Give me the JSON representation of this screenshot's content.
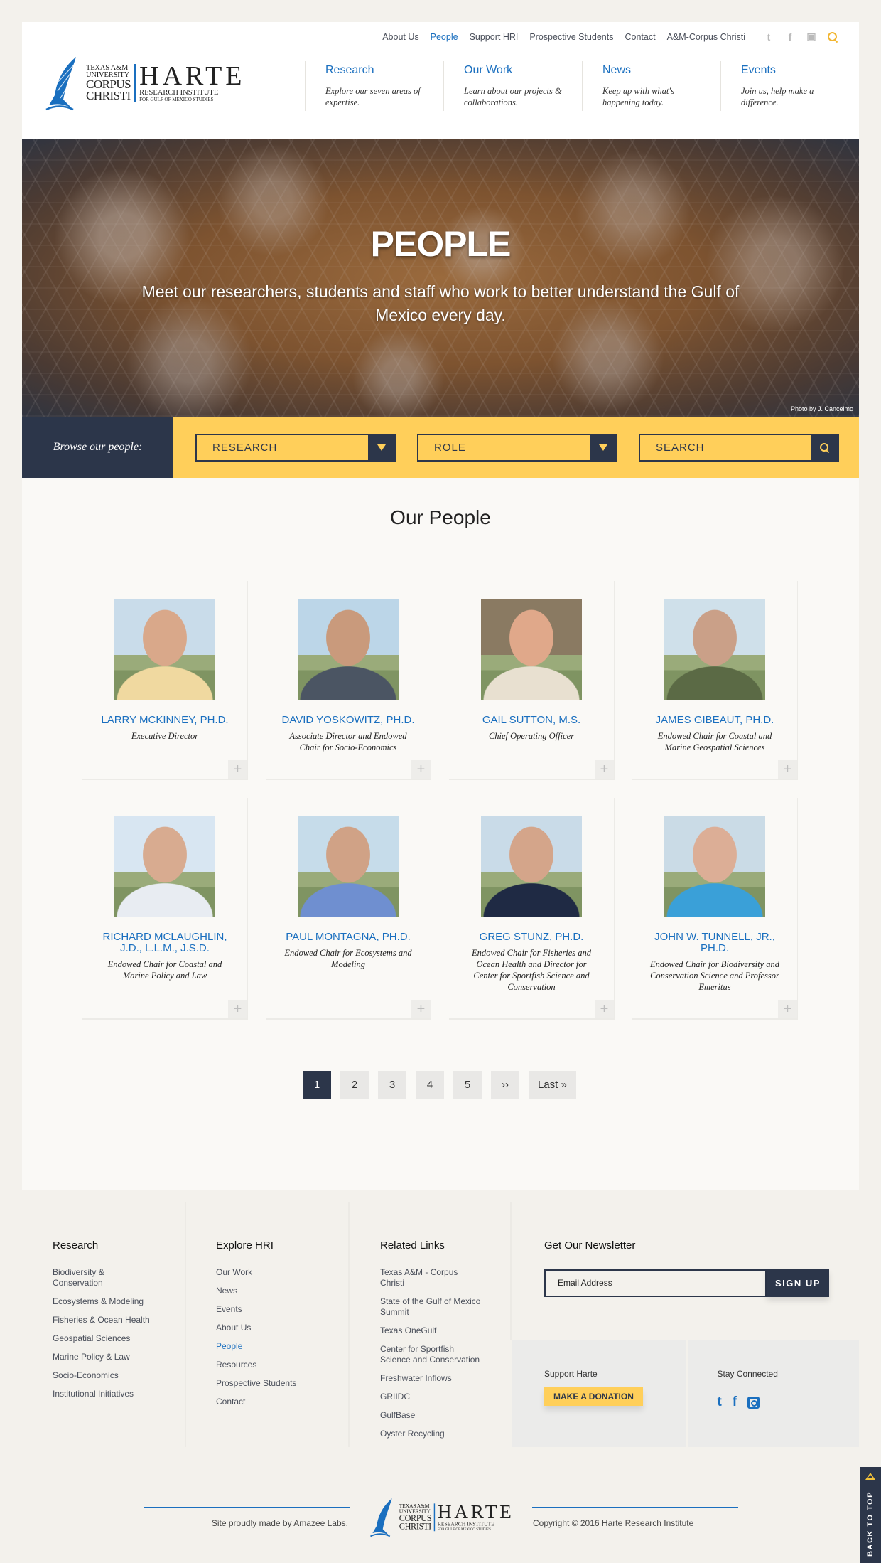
{
  "utility_nav": {
    "links": [
      {
        "label": "About Us",
        "active": false
      },
      {
        "label": "People",
        "active": true
      },
      {
        "label": "Support HRI",
        "active": false
      },
      {
        "label": "Prospective Students",
        "active": false
      },
      {
        "label": "Contact",
        "active": false
      },
      {
        "label": "A&M-Corpus Christi",
        "active": false
      }
    ],
    "icons": [
      "twitter-icon",
      "facebook-icon",
      "instagram-icon",
      "search-icon"
    ]
  },
  "logo": {
    "line1": "TEXAS A&M",
    "line2": "UNIVERSITY",
    "line3": "CORPUS",
    "line4": "CHRISTI",
    "name": "HARTE",
    "sub1": "RESEARCH INSTITUTE",
    "sub2": "FOR GULF OF MEXICO STUDIES"
  },
  "main_nav": [
    {
      "title": "Research",
      "desc": "Explore our seven areas of expertise."
    },
    {
      "title": "Our Work",
      "desc": "Learn about our projects & collaborations."
    },
    {
      "title": "News",
      "desc": "Keep up with what's happening today."
    },
    {
      "title": "Events",
      "desc": "Join us, help make a difference."
    }
  ],
  "hero": {
    "title": "PEOPLE",
    "subtitle": "Meet our researchers, students and staff who work to better understand the Gulf of Mexico every day.",
    "credit": "Photo by J. Cancelmo"
  },
  "filter": {
    "label": "Browse our people:",
    "research": "RESEARCH",
    "role": "ROLE",
    "search": "SEARCH"
  },
  "people": {
    "heading": "Our People",
    "cards": [
      {
        "name": "Larry McKinney, Ph.D.",
        "role": "Executive Director"
      },
      {
        "name": "David Yoskowitz, Ph.D.",
        "role": "Associate Director and Endowed Chair for Socio-Economics"
      },
      {
        "name": "Gail Sutton, M.S.",
        "role": "Chief Operating Officer"
      },
      {
        "name": "James Gibeaut, Ph.D.",
        "role": "Endowed Chair for Coastal and Marine Geospatial Sciences"
      },
      {
        "name": "Richard McLaughlin, J.D., L.L.M., J.S.D.",
        "role": "Endowed Chair for Coastal and Marine Policy and Law"
      },
      {
        "name": "Paul Montagna, Ph.D.",
        "role": "Endowed Chair for Ecosystems and Modeling"
      },
      {
        "name": "Greg Stunz, Ph.D.",
        "role": "Endowed Chair for Fisheries and Ocean Health and Director for Center for Sportfish Science and Conservation"
      },
      {
        "name": "John W. Tunnell, Jr., Ph.D.",
        "role": "Endowed Chair for Biodiversity and Conservation Science and Professor Emeritus"
      }
    ],
    "expand_label": "+"
  },
  "pager": {
    "pages": [
      "1",
      "2",
      "3",
      "4",
      "5"
    ],
    "current": "1",
    "next": "››",
    "last": "Last »"
  },
  "footer": {
    "research": {
      "heading": "Research",
      "links": [
        "Biodiversity & Conservation",
        "Ecosystems & Modeling",
        "Fisheries & Ocean Health",
        "Geospatial Sciences",
        "Marine Policy & Law",
        "Socio-Economics",
        "Institutional Initiatives"
      ]
    },
    "explore": {
      "heading": "Explore HRI",
      "links": [
        "Our Work",
        "News",
        "Events",
        "About Us",
        "People",
        "Resources",
        "Prospective Students",
        "Contact"
      ],
      "active": "People"
    },
    "related": {
      "heading": "Related Links",
      "links": [
        "Texas A&M - Corpus Christi",
        "State of the Gulf of Mexico Summit",
        "Texas OneGulf",
        "Center for Sportfish Science and Conservation",
        "Freshwater Inflows",
        "GRIIDC",
        "GulfBase",
        "Oyster Recycling"
      ]
    },
    "newsletter": {
      "heading": "Get Our Newsletter",
      "placeholder": "Email Address",
      "button": "SIGN UP"
    },
    "support": {
      "label": "Support Harte",
      "button": "MAKE A DONATION"
    },
    "connected": {
      "label": "Stay Connected"
    },
    "made_by": "Site proudly made by Amazee Labs.",
    "copyright": "Copyright © 2016 Harte Research Institute",
    "back_to_top": "BACK TO TOP"
  },
  "colors": {
    "accent_blue": "#1a6fbf",
    "navy": "#2c364a",
    "yellow": "#ffcf5a"
  }
}
